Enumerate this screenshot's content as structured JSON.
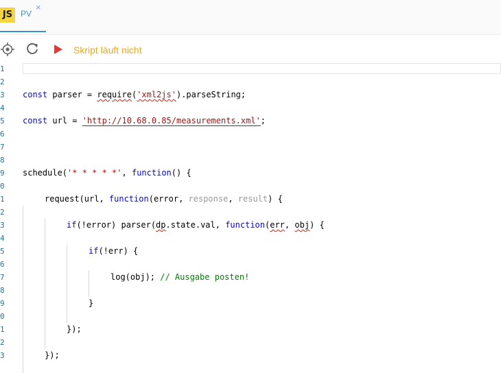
{
  "tab": {
    "badge": "JS",
    "label": "PV",
    "close": "×"
  },
  "toolbar": {
    "status": "Skript läuft nicht"
  },
  "colors": {
    "accent": "#3a8fd6",
    "status": "#e8a817",
    "run": "#e53935",
    "js_badge": "#f5d53d"
  },
  "gutter": [
    "1",
    "2",
    "3",
    "4",
    "5",
    "6",
    "7",
    "8",
    "9",
    "0",
    "1",
    "2",
    "3",
    "4",
    "5",
    "6",
    "7",
    "8",
    "9",
    "0",
    "1",
    "2",
    "3"
  ],
  "code": {
    "l3": {
      "a": "const",
      "b": " parser = ",
      "c": "require",
      "d": "(",
      "e": "'xml2js'",
      "f": ").parseString;"
    },
    "l5": {
      "a": "const",
      "b": " url = ",
      "c": "'http://10.68.0.85/measurements.xml'",
      "d": ";"
    },
    "l9": {
      "a": "schedule(",
      "b": "'* * * * *'",
      "c": ", ",
      "d": "function",
      "e": "() {"
    },
    "l11": {
      "a": "request(url, ",
      "b": "function",
      "c": "(error, ",
      "d": "response",
      "e": ", ",
      "f": "result",
      "g": ") {"
    },
    "l13": {
      "a": "if",
      "b": "(!error) parser(",
      "c": "dp",
      "d": ".state.val, ",
      "e": "function",
      "f": "(",
      "g": "err",
      "h": ", ",
      "i": "obj",
      "j": ") {"
    },
    "l15": {
      "a": "if",
      "b": "(!err) {"
    },
    "l17": {
      "a": "log(obj); ",
      "b": "// Ausgabe posten!"
    },
    "l19": {
      "a": "}"
    },
    "l21": {
      "a": "});"
    },
    "l23": {
      "a": "});"
    }
  }
}
